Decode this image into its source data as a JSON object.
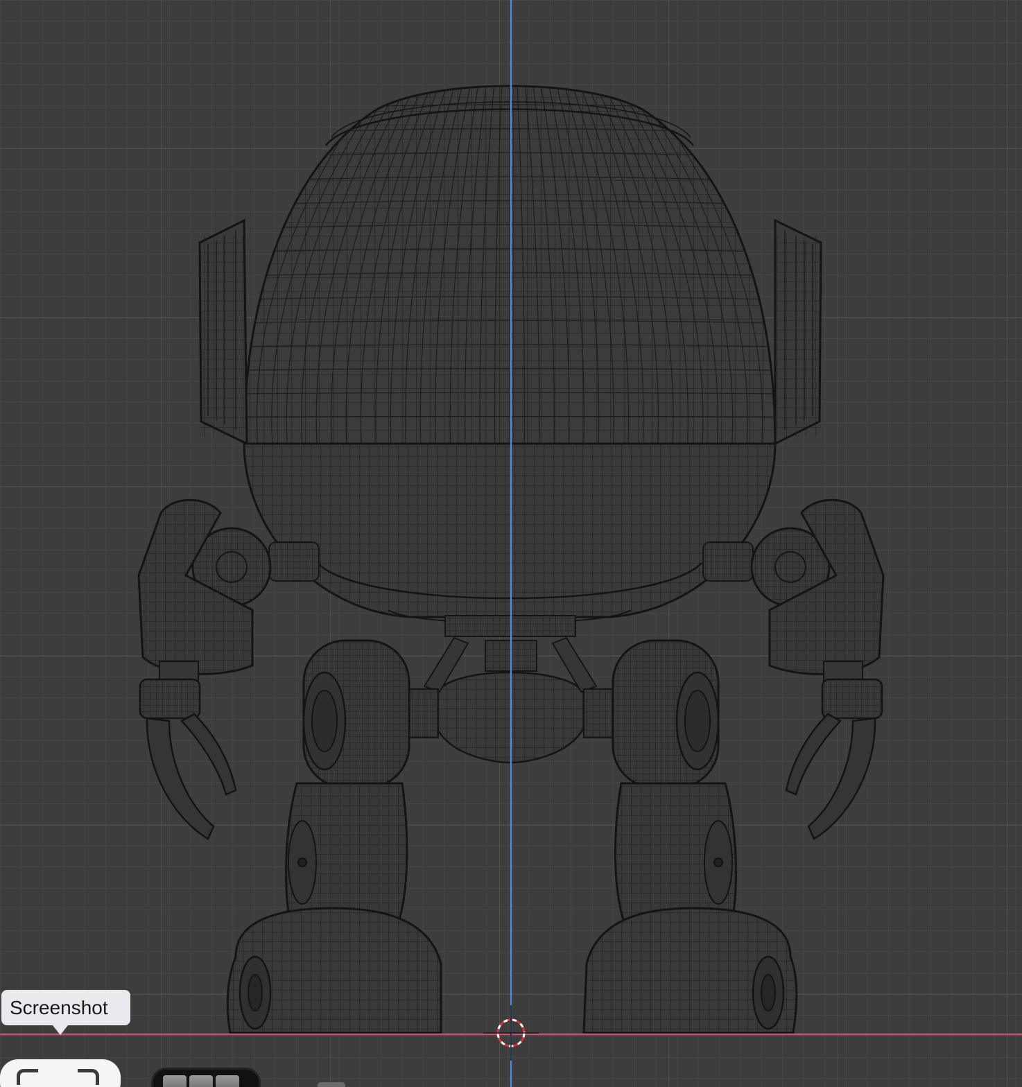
{
  "viewport": {
    "background": "#3d3d3d",
    "grid_minor_color": "#4a4a4a",
    "grid_major_color": "#565656",
    "axis_y_color": "#4f8bd6",
    "axis_x_color": "#c9506a",
    "wire_color": "#1d1d1d",
    "model_fill": "#3a3a3a",
    "icons": {
      "cursor": "3d-cursor-icon",
      "tool": "screenshot-selection-icon"
    }
  },
  "tooltip": {
    "label": "Screenshot"
  },
  "toolbar": {
    "colors": {
      "button_bg": "#f5f5f7",
      "strip_bg": "#111111"
    }
  }
}
